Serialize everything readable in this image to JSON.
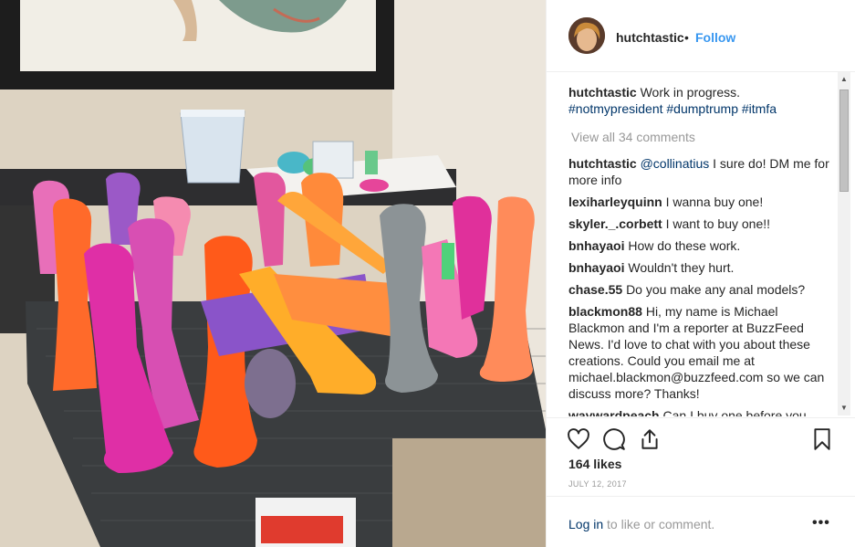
{
  "header": {
    "username": "hutchtastic",
    "separator": "•",
    "follow_label": "Follow"
  },
  "caption": {
    "username": "hutchtastic",
    "text": "Work in progress.",
    "hashtags": "#notmypresident #dumptrump #itmfa"
  },
  "view_all": "View all 34 comments",
  "comments": [
    {
      "user": "hutchtastic",
      "mention": "@collinatius",
      "text": " I sure do! DM me for more info"
    },
    {
      "user": "lexiharleyquinn",
      "mention": "",
      "text": "I wanna buy one!"
    },
    {
      "user": "skyler._.corbett",
      "mention": "",
      "text": "I want to buy one!!"
    },
    {
      "user": "bnhayaoi",
      "mention": "",
      "text": "How do these work."
    },
    {
      "user": "bnhayaoi",
      "mention": "",
      "text": "Wouldn't they hurt."
    },
    {
      "user": "chase.55",
      "mention": "",
      "text": "Do you make any anal models?"
    },
    {
      "user": "blackmon88",
      "mention": "",
      "text": "Hi, my name is Michael Blackmon and I'm a reporter at BuzzFeed News. I'd love to chat with you about these creations. Could you email me at michael.blackmon@buzzfeed.com so we can discuss more? Thanks!"
    },
    {
      "user": "waywardpeach",
      "mention": "",
      "text": "Can I buy one before you"
    }
  ],
  "likes": "164 likes",
  "date": "JULY 12, 2017",
  "footer": {
    "login_link": "Log in",
    "login_rest": " to like or comment.",
    "more": "•••"
  },
  "icons": {
    "like": "heart-icon",
    "comment": "comment-bubble-icon",
    "share": "share-icon",
    "save": "bookmark-icon",
    "more": "more-options-icon"
  },
  "colors": {
    "link_blue": "#3897f0",
    "tag_blue": "#003569",
    "muted": "#999999",
    "text": "#262626"
  }
}
